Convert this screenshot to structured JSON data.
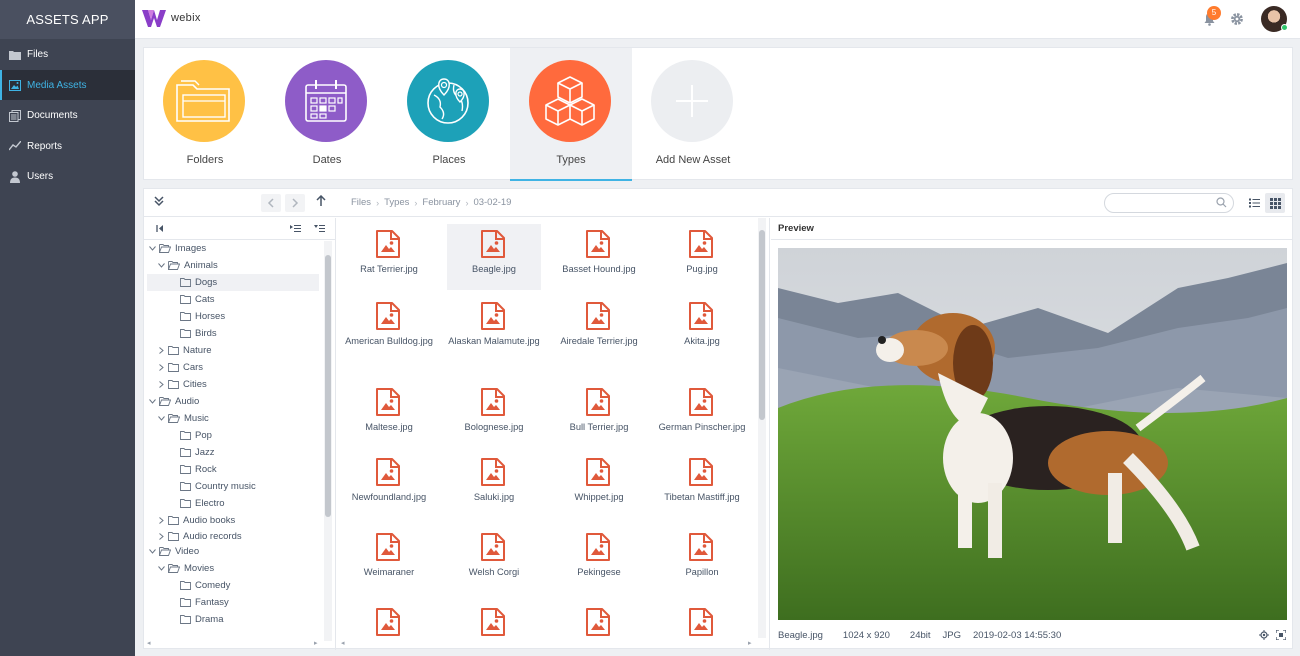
{
  "app": {
    "title": "ASSETS APP",
    "logo_text": "webix"
  },
  "sidebar": {
    "items": [
      {
        "label": "Files",
        "icon": "folder-icon",
        "active": false
      },
      {
        "label": "Media Assets",
        "icon": "image-icon",
        "active": true
      },
      {
        "label": "Documents",
        "icon": "documents-icon",
        "active": false
      },
      {
        "label": "Reports",
        "icon": "chart-line-icon",
        "active": false
      },
      {
        "label": "Users",
        "icon": "user-icon",
        "active": false
      }
    ]
  },
  "header": {
    "notifications_count": "5"
  },
  "categories": [
    {
      "label": "Folders",
      "color": "#ffc145",
      "icon": "folders-icon"
    },
    {
      "label": "Dates",
      "color": "#8e5cc8",
      "icon": "calendar-icon"
    },
    {
      "label": "Places",
      "color": "#1da1b8",
      "icon": "globe-pin-icon"
    },
    {
      "label": "Types",
      "color": "#ff6a3d",
      "icon": "cubes-icon",
      "active": true
    },
    {
      "label": "Add New Asset",
      "color": "#eceef1",
      "icon": "plus-icon"
    }
  ],
  "breadcrumbs": [
    "Files",
    "Types",
    "February",
    "03-02-19"
  ],
  "search": {
    "placeholder": "",
    "value": ""
  },
  "tree": {
    "nodes": [
      {
        "label": "Images",
        "depth": 0,
        "expanded": true,
        "has_children": true
      },
      {
        "label": "Animals",
        "depth": 1,
        "expanded": true,
        "has_children": true
      },
      {
        "label": "Dogs",
        "depth": 2,
        "selected": true
      },
      {
        "label": "Cats",
        "depth": 2
      },
      {
        "label": "Horses",
        "depth": 2
      },
      {
        "label": "Birds",
        "depth": 2
      },
      {
        "label": "Nature",
        "depth": 1,
        "expanded": false,
        "has_children": true
      },
      {
        "label": "Cars",
        "depth": 1,
        "expanded": false,
        "has_children": true
      },
      {
        "label": "Cities",
        "depth": 1,
        "expanded": false,
        "has_children": true
      },
      {
        "label": "Audio",
        "depth": 0,
        "expanded": true,
        "has_children": true
      },
      {
        "label": "Music",
        "depth": 1,
        "expanded": true,
        "has_children": true
      },
      {
        "label": "Pop",
        "depth": 2
      },
      {
        "label": "Jazz",
        "depth": 2
      },
      {
        "label": "Rock",
        "depth": 2
      },
      {
        "label": "Country music",
        "depth": 2
      },
      {
        "label": "Electro",
        "depth": 2
      },
      {
        "label": "Audio books",
        "depth": 1,
        "expanded": false,
        "has_children": true
      },
      {
        "label": "Audio records",
        "depth": 1,
        "expanded": false,
        "has_children": true
      },
      {
        "label": "Video",
        "depth": 0,
        "expanded": true,
        "has_children": true
      },
      {
        "label": "Movies",
        "depth": 1,
        "expanded": true,
        "has_children": true
      },
      {
        "label": "Comedy",
        "depth": 2
      },
      {
        "label": "Fantasy",
        "depth": 2
      },
      {
        "label": "Drama",
        "depth": 2
      }
    ]
  },
  "files": [
    {
      "name": "Rat Terrier.jpg"
    },
    {
      "name": "Beagle.jpg",
      "selected": true
    },
    {
      "name": "Basset Hound.jpg"
    },
    {
      "name": "Pug.jpg"
    },
    {
      "name": "American Bulldog.jpg"
    },
    {
      "name": "Alaskan Malamute.jpg"
    },
    {
      "name": "Airedale Terrier.jpg"
    },
    {
      "name": "Akita.jpg"
    },
    {
      "name": "Maltese.jpg"
    },
    {
      "name": "Bolognese.jpg"
    },
    {
      "name": "Bull Terrier.jpg"
    },
    {
      "name": "German Pinscher.jpg"
    },
    {
      "name": "Newfoundland.jpg"
    },
    {
      "name": "Saluki.jpg"
    },
    {
      "name": "Whippet.jpg"
    },
    {
      "name": "Tibetan Mastiff.jpg"
    },
    {
      "name": "Weimaraner"
    },
    {
      "name": "Welsh Corgi"
    },
    {
      "name": "Pekingese"
    },
    {
      "name": "Papillon"
    },
    {
      "name": ""
    },
    {
      "name": ""
    },
    {
      "name": ""
    },
    {
      "name": ""
    }
  ],
  "preview": {
    "title": "Preview",
    "file_name": "Beagle.jpg",
    "dimensions": "1024 x 920",
    "depth": "24bit",
    "format": "JPG",
    "modified": "2019-02-03 14:55:30"
  },
  "colors": {
    "accent": "#3fb3e4",
    "file_icon": "#e0593b",
    "sidebar_bg": "#3e4452"
  }
}
